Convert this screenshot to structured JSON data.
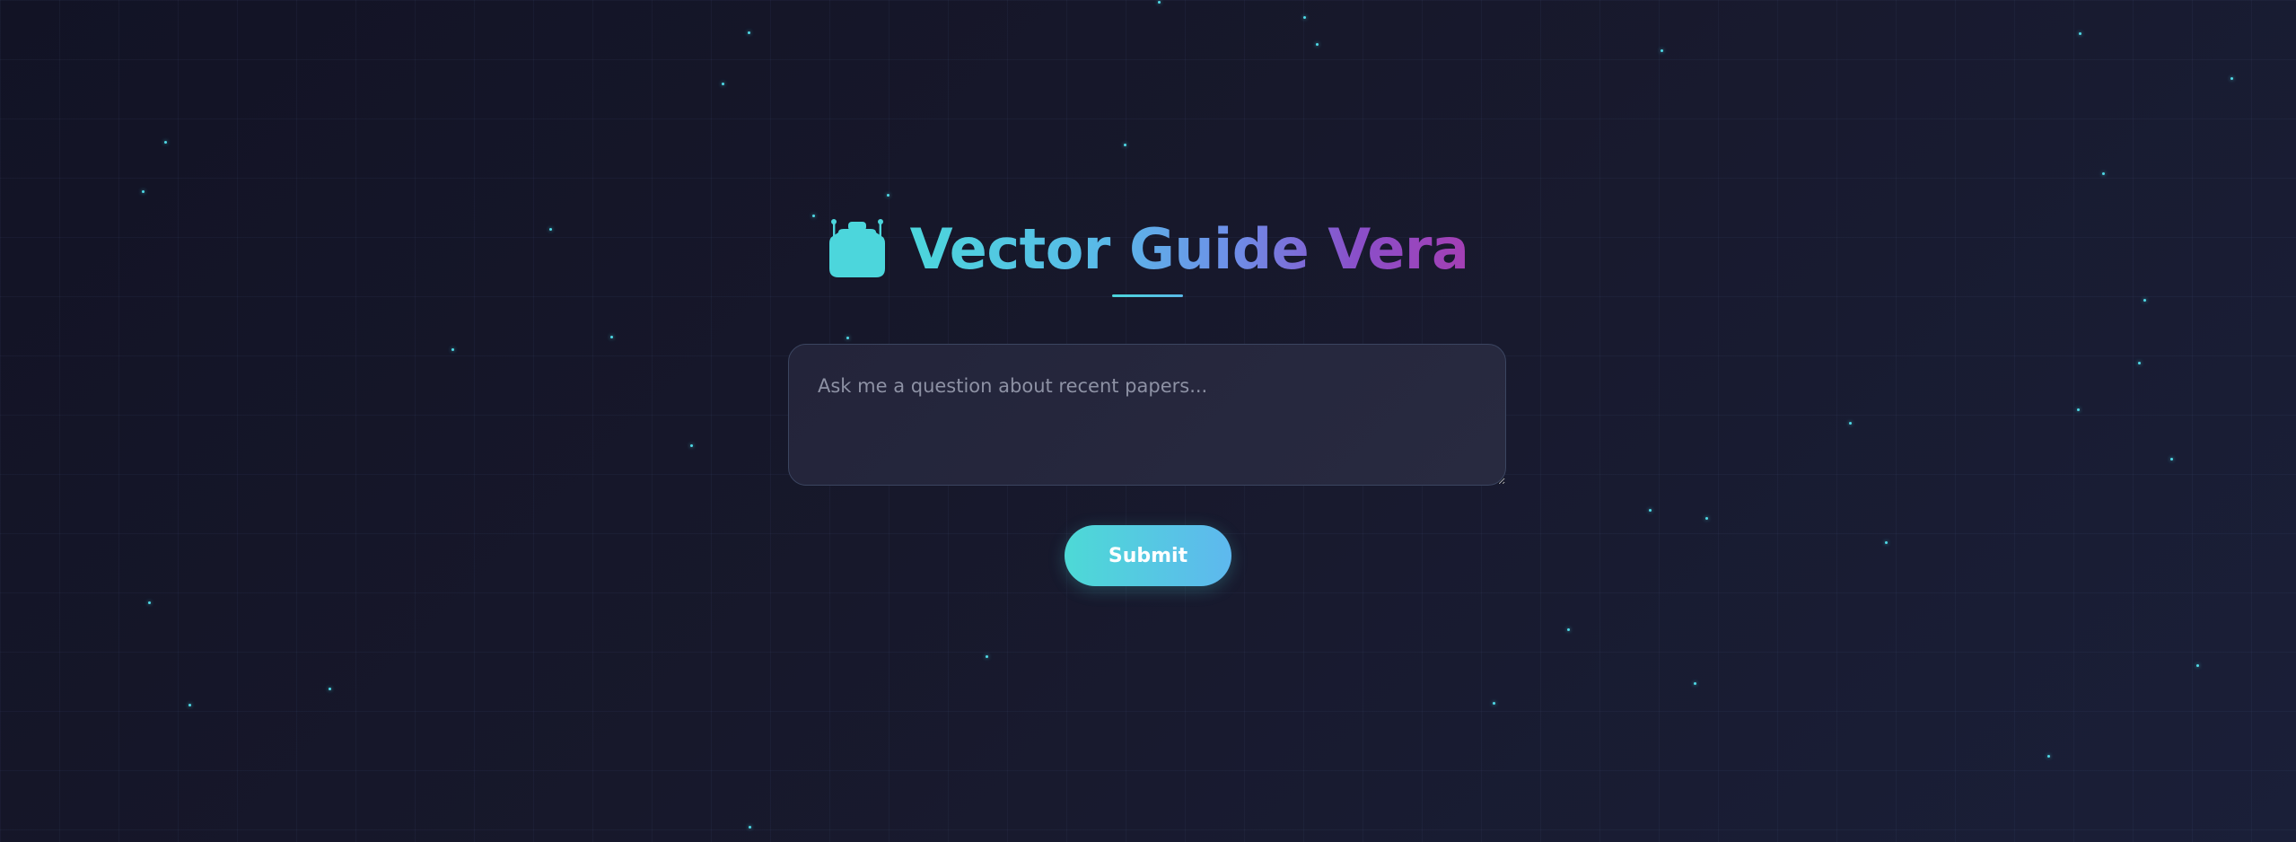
{
  "app": {
    "title": "Vector Guide Vera"
  },
  "header": {
    "icon": "robot-icon",
    "title": "Vector Guide Vera"
  },
  "query": {
    "value": "",
    "placeholder": "Ask me a question about recent papers..."
  },
  "actions": {
    "submit_label": "Submit"
  },
  "colors": {
    "accent_teal": "#4cd6dc",
    "accent_blue": "#5ab9e8",
    "accent_purple": "#a43fb4",
    "background": "#15162a",
    "star": "#4fd9e6"
  }
}
